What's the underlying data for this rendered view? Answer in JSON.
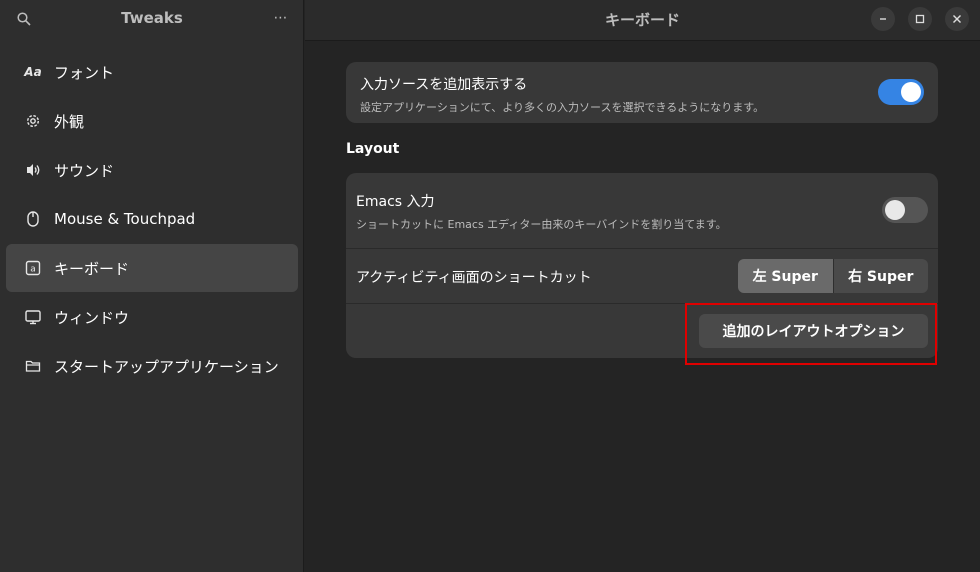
{
  "sidebar": {
    "app_title": "Tweaks",
    "menu_label": "⋯",
    "items": [
      {
        "label": "フォント",
        "icon": "font-icon"
      },
      {
        "label": "外観",
        "icon": "gear-icon"
      },
      {
        "label": "サウンド",
        "icon": "speaker-icon"
      },
      {
        "label": "Mouse & Touchpad",
        "icon": "mouse-icon"
      },
      {
        "label": "キーボード",
        "icon": "keyboard-icon"
      },
      {
        "label": "ウィンドウ",
        "icon": "monitor-icon"
      },
      {
        "label": "スタートアップアプリケーション",
        "icon": "folder-icon"
      }
    ],
    "font_glyph": "Aa",
    "active_index": 4
  },
  "main": {
    "title": "キーボード",
    "input_sources": {
      "title": "入力ソースを追加表示する",
      "subtitle": "設定アプリケーションにて、より多くの入力ソースを選択できるようになります。",
      "enabled": true
    },
    "layout_section": "Layout",
    "emacs": {
      "title": "Emacs 入力",
      "subtitle": "ショートカットに Emacs エディター由来のキーバインドを割り当てます。",
      "enabled": false
    },
    "overview_shortcut": {
      "title": "アクティビティ画面のショートカット",
      "options": [
        "左 Super",
        "右 Super"
      ],
      "selected": "左 Super"
    },
    "extra_layout_button": "追加のレイアウトオプション"
  },
  "colors": {
    "accent": "#3584e4",
    "highlight": "#e00000"
  }
}
